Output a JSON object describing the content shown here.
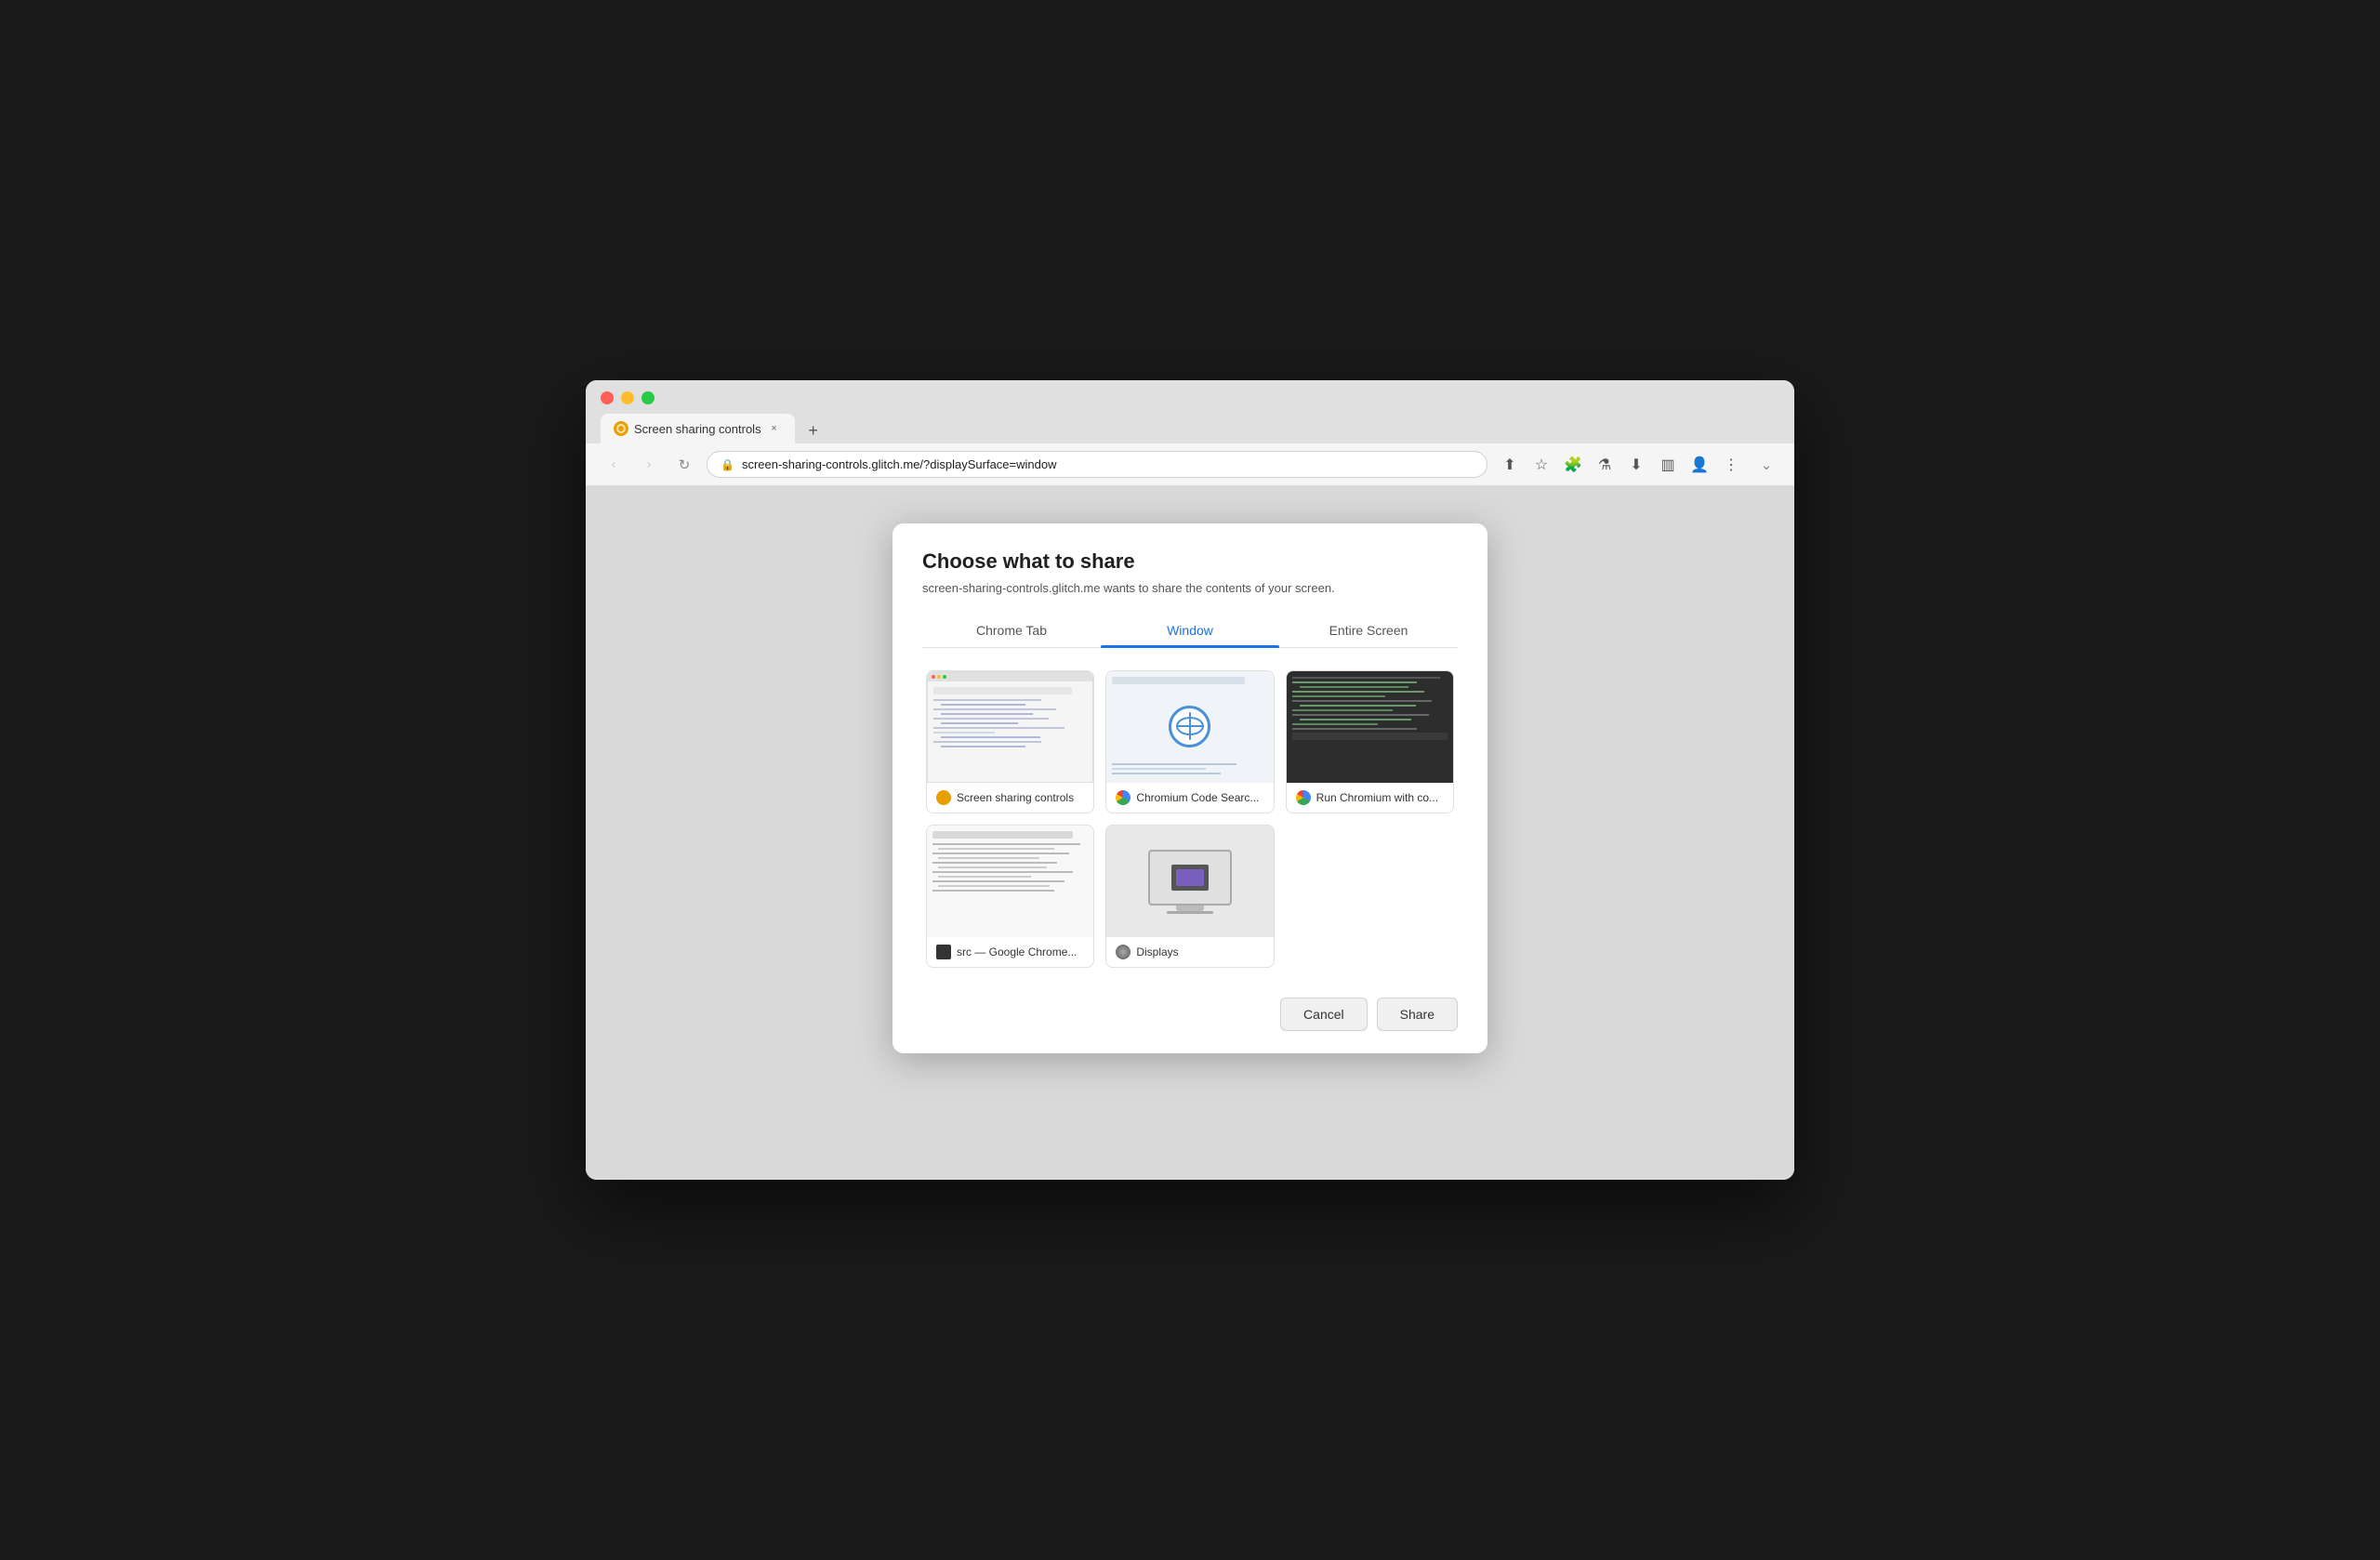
{
  "browser": {
    "tab_title": "Screen sharing controls",
    "tab_close_label": "×",
    "new_tab_label": "+",
    "address": "screen-sharing-controls.glitch.me/?displaySurface=window",
    "dropdown_label": "⌄"
  },
  "nav": {
    "back_label": "‹",
    "forward_label": "›",
    "reload_label": "↻"
  },
  "dialog": {
    "title": "Choose what to share",
    "subtitle": "screen-sharing-controls.glitch.me wants to share the contents of your screen.",
    "tabs": [
      {
        "id": "chrome-tab",
        "label": "Chrome Tab",
        "active": false
      },
      {
        "id": "window",
        "label": "Window",
        "active": true
      },
      {
        "id": "entire-screen",
        "label": "Entire Screen",
        "active": false
      }
    ],
    "windows": [
      {
        "id": "screen-sharing-controls",
        "label": "Screen sharing controls",
        "favicon_type": "orange"
      },
      {
        "id": "chromium-code-search",
        "label": "Chromium Code Searc...",
        "favicon_type": "chrome"
      },
      {
        "id": "run-chromium",
        "label": "Run Chromium with co...",
        "favicon_type": "chrome"
      },
      {
        "id": "src-google-chrome",
        "label": "src — Google Chrome...",
        "favicon_type": "black"
      },
      {
        "id": "displays",
        "label": "Displays",
        "favicon_type": "displays"
      }
    ],
    "cancel_label": "Cancel",
    "share_label": "Share"
  }
}
